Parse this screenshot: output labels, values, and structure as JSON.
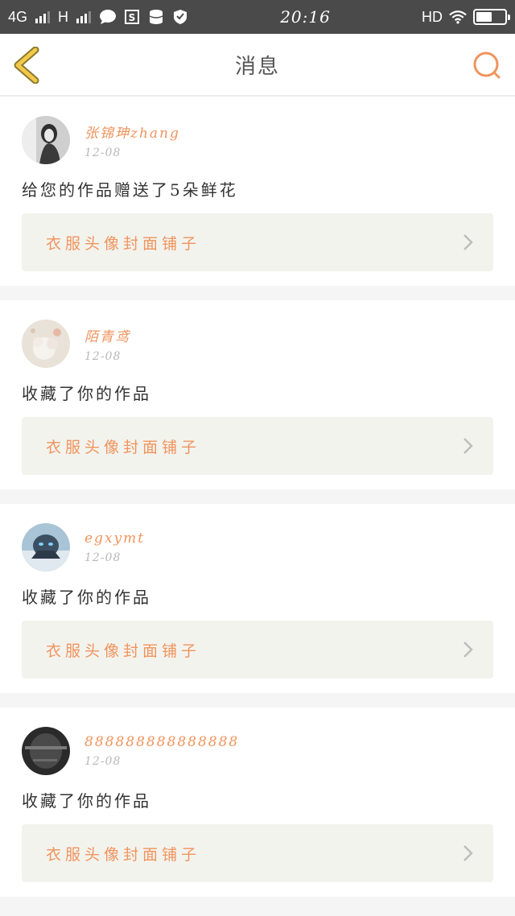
{
  "status_bar": {
    "network_1": "4G",
    "network_2": "H",
    "time": "20:16",
    "hd": "HD",
    "battery_level": 0.55
  },
  "nav": {
    "title": "消息",
    "back_icon": "chevron-left-icon",
    "search_icon": "search-icon",
    "accent_color": "#f0945d"
  },
  "messages": [
    {
      "username": "张锦珅zhang",
      "date": "12-08",
      "action": "给您的作品赠送了5朵鲜花",
      "link_label": "衣服头像封面铺子"
    },
    {
      "username": "陌青鸢",
      "date": "12-08",
      "action": "收藏了你的作品",
      "link_label": "衣服头像封面铺子"
    },
    {
      "username": "egxymt",
      "date": "12-08",
      "action": "收藏了你的作品",
      "link_label": "衣服头像封面铺子"
    },
    {
      "username": "888888888888888",
      "date": "12-08",
      "action": "收藏了你的作品",
      "link_label": "衣服头像封面铺子"
    }
  ]
}
